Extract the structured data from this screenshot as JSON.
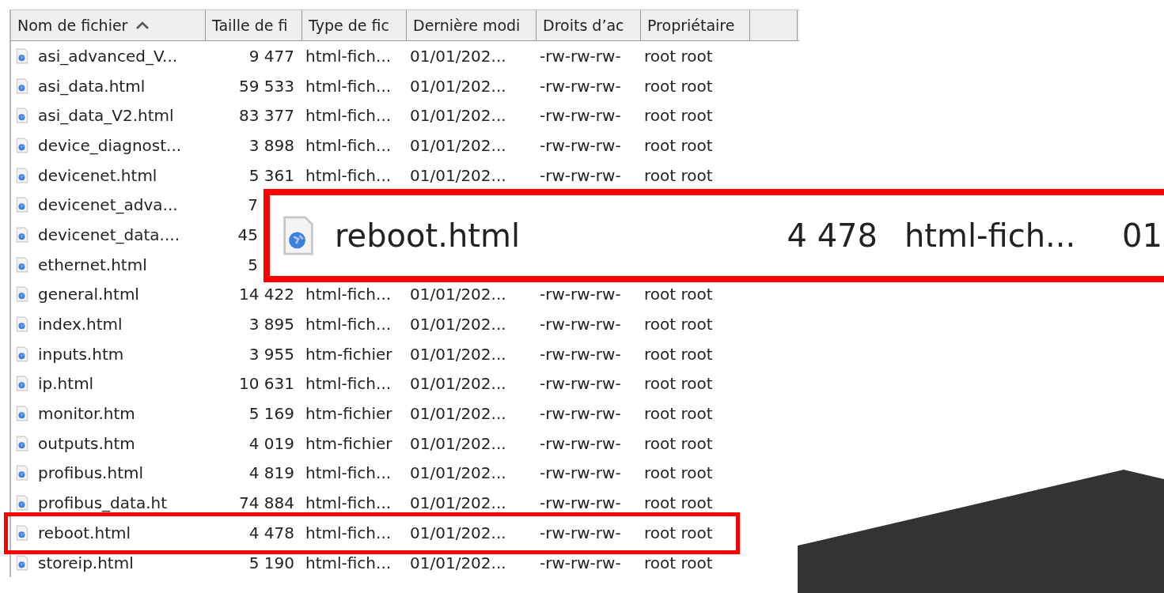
{
  "table": {
    "columns": [
      {
        "label": "Nom de fichier",
        "sorted": true
      },
      {
        "label": "Taille de fi",
        "sorted": false
      },
      {
        "label": "Type de fic",
        "sorted": false
      },
      {
        "label": "Dernière modi",
        "sorted": false
      },
      {
        "label": "Droits d’ac",
        "sorted": false
      },
      {
        "label": "Propriétaire",
        "sorted": false
      }
    ],
    "rows": [
      {
        "name": "asi_advanced_V...",
        "size": "9 477",
        "type": "html-fich...",
        "modified": "01/01/202...",
        "rights": "-rw-rw-rw-",
        "owner": "root root"
      },
      {
        "name": "asi_data.html",
        "size": "59 533",
        "type": "html-fich...",
        "modified": "01/01/202...",
        "rights": "-rw-rw-rw-",
        "owner": "root root"
      },
      {
        "name": "asi_data_V2.html",
        "size": "83 377",
        "type": "html-fich...",
        "modified": "01/01/202...",
        "rights": "-rw-rw-rw-",
        "owner": "root root"
      },
      {
        "name": "device_diagnost...",
        "size": "3 898",
        "type": "html-fich...",
        "modified": "01/01/202...",
        "rights": "-rw-rw-rw-",
        "owner": "root root"
      },
      {
        "name": "devicenet.html",
        "size": "5 361",
        "type": "html-fich...",
        "modified": "01/01/202...",
        "rights": "-rw-rw-rw-",
        "owner": "root root"
      },
      {
        "name": "devicenet_adva...",
        "size": "7"
      },
      {
        "name": "devicenet_data....",
        "size": "45"
      },
      {
        "name": "ethernet.html",
        "size": "5"
      },
      {
        "name": "general.html",
        "size": "14 422",
        "type": "html-fich...",
        "modified": "01/01/202...",
        "rights": "-rw-rw-rw-",
        "owner": "root root"
      },
      {
        "name": "index.html",
        "size": "3 895",
        "type": "html-fich...",
        "modified": "01/01/202...",
        "rights": "-rw-rw-rw-",
        "owner": "root root"
      },
      {
        "name": "inputs.htm",
        "size": "3 955",
        "type": "htm-fichier",
        "modified": "01/01/202...",
        "rights": "-rw-rw-rw-",
        "owner": "root root"
      },
      {
        "name": "ip.html",
        "size": "10 631",
        "type": "html-fich...",
        "modified": "01/01/202...",
        "rights": "-rw-rw-rw-",
        "owner": "root root"
      },
      {
        "name": "monitor.htm",
        "size": "5 169",
        "type": "htm-fichier",
        "modified": "01/01/202...",
        "rights": "-rw-rw-rw-",
        "owner": "root root"
      },
      {
        "name": "outputs.htm",
        "size": "4 019",
        "type": "htm-fichier",
        "modified": "01/01/202...",
        "rights": "-rw-rw-rw-",
        "owner": "root root"
      },
      {
        "name": "profibus.html",
        "size": "4 819",
        "type": "html-fich...",
        "modified": "01/01/202...",
        "rights": "-rw-rw-rw-",
        "owner": "root root"
      },
      {
        "name": "profibus_data.ht",
        "size": "74 884",
        "type": "html-fich...",
        "modified": "01/01/202...",
        "rights": "-rw-rw-rw-",
        "owner": "root root"
      },
      {
        "name": "reboot.html",
        "size": "4 478",
        "type": "html-fich...",
        "modified": "01/01/202...",
        "rights": "-rw-rw-rw-",
        "owner": "root root"
      },
      {
        "name": "storeip.html",
        "size": "5 190",
        "type": "html-fich...",
        "modified": "01/01/202...",
        "rights": "-rw-rw-rw-",
        "owner": "root root"
      }
    ]
  },
  "magnified_row": {
    "name": "reboot.html",
    "size": "4 478",
    "type": "html-fich...",
    "modified": "01"
  }
}
